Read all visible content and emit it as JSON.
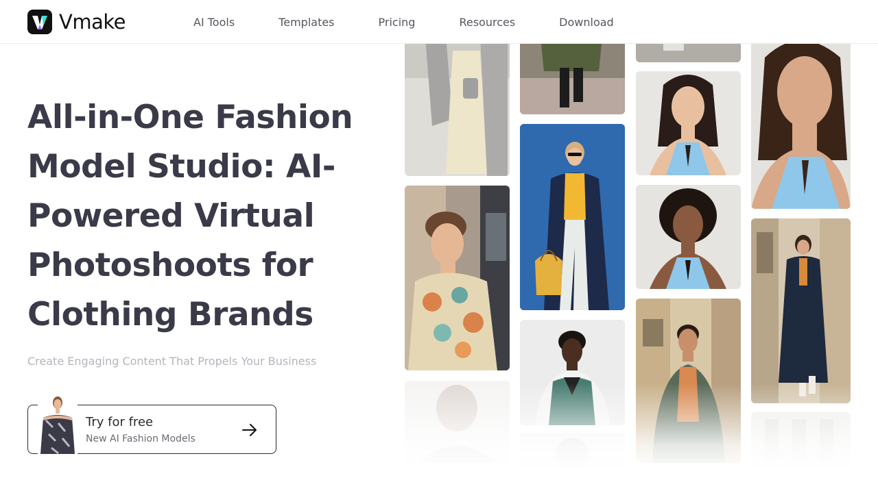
{
  "header": {
    "brand": "Vmake",
    "nav": [
      {
        "label": "AI Tools"
      },
      {
        "label": "Templates"
      },
      {
        "label": "Pricing"
      },
      {
        "label": "Resources"
      },
      {
        "label": "Download"
      }
    ]
  },
  "hero": {
    "title_lines": [
      "All-in-One Fashion",
      "Model Studio: AI-",
      "Powered Virtual",
      "Photoshoots for",
      "Clothing Brands"
    ],
    "subtitle": "Create Engaging Content That Propels Your Business",
    "cta": {
      "title": "Try for free",
      "subtitle": "New AI Fashion Models",
      "icon": "arrow-right-icon"
    }
  },
  "gallery": {
    "photos": [
      "street-woman-yellow-trousers",
      "man-floral-tshirt",
      "street-coat-legs",
      "woman-blue-wall-yellow-sweater",
      "man-green-varsity-jacket",
      "woman-light-blue-halter",
      "woman-curly-hair-blue-halter",
      "man-green-shirt-street",
      "woman-blue-halter-closeup",
      "woman-navy-coat-street"
    ]
  },
  "colors": {
    "title": "#3a3a48",
    "subtitle": "#b4b4bc",
    "nav": "#55555e"
  }
}
